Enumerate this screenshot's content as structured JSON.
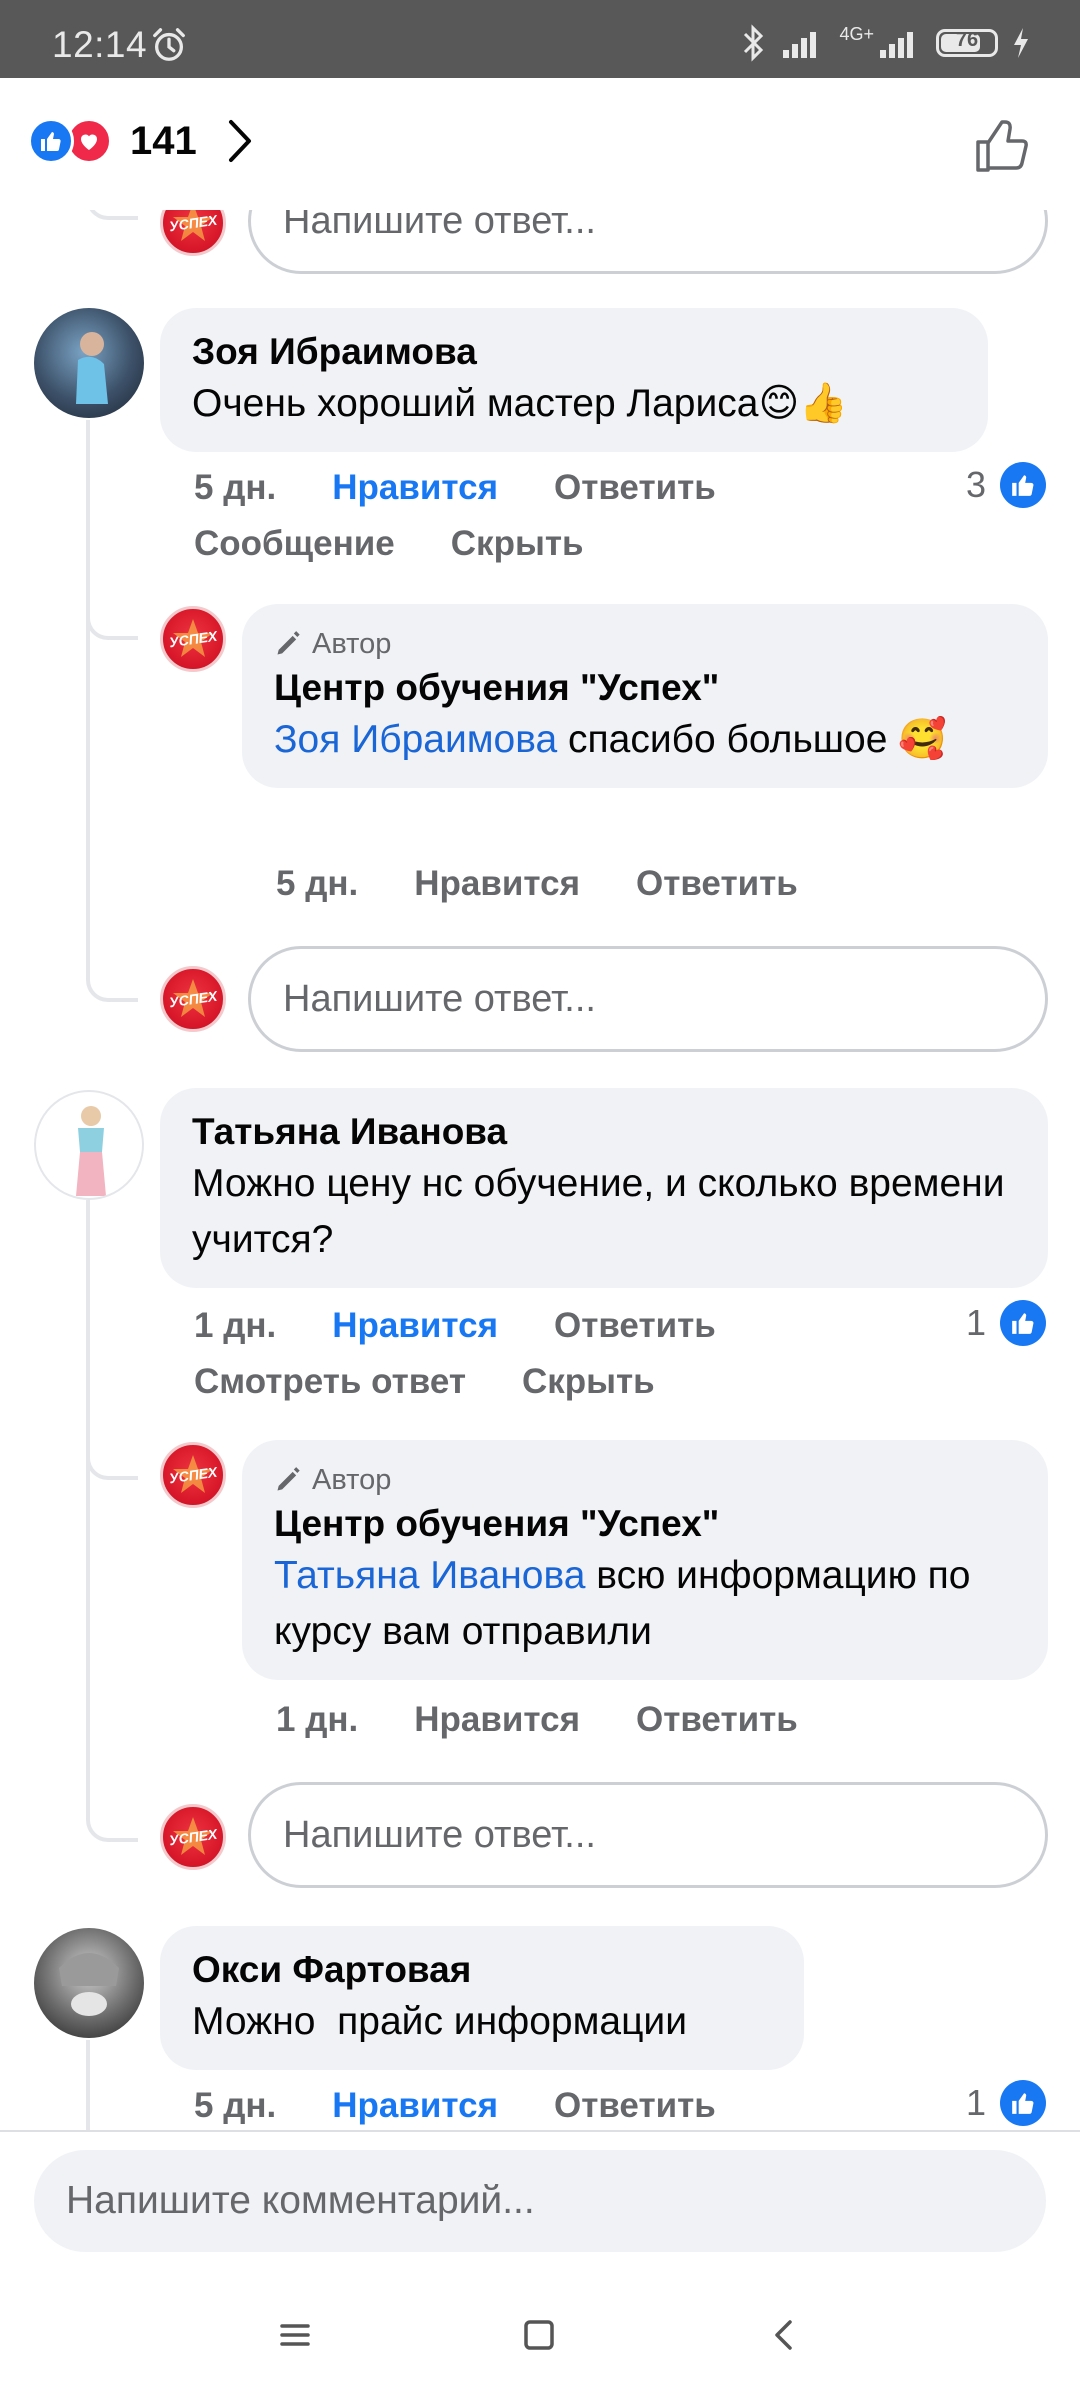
{
  "status_bar": {
    "time": "12:14",
    "network": "4G+",
    "battery": "76"
  },
  "header": {
    "reaction_count": "141"
  },
  "reply_placeholder": "Напишите ответ...",
  "comments": [
    {
      "name": "Зоя Ибраимова",
      "text": "Очень хороший мастер Лариса😊👍",
      "time": "5 дн.",
      "like_label": "Нравится",
      "reply_label": "Ответить",
      "message_label": "Сообщение",
      "hide_label": "Скрыть",
      "likes": "3",
      "reply": {
        "author_tag": "Автор",
        "name": "Центр обучения \"Успех\"",
        "mention": "Зоя Ибраимова",
        "text": " спасибо большое 🥰",
        "time": "5 дн.",
        "like_label": "Нравится",
        "reply_label": "Ответить"
      }
    },
    {
      "name": "Татьяна Иванова",
      "text": "Можно цену нс обучение, и сколько времени учится?",
      "time": "1 дн.",
      "like_label": "Нравится",
      "reply_label": "Ответить",
      "view_reply_label": "Смотреть ответ",
      "hide_label": "Скрыть",
      "likes": "1",
      "reply": {
        "author_tag": "Автор",
        "name": "Центр обучения \"Успех\"",
        "mention": "Татьяна Иванова",
        "text": " всю информацию по курсу вам отправили",
        "time": "1 дн.",
        "like_label": "Нравится",
        "reply_label": "Ответить"
      }
    },
    {
      "name": "Окси Фартовая",
      "text": "Можно  прайс информации",
      "time": "5 дн.",
      "like_label": "Нравится",
      "reply_label": "Ответить",
      "likes": "1"
    }
  ],
  "composer": {
    "placeholder": "Напишите комментарий..."
  },
  "colors": {
    "accent": "#1877f2",
    "love": "#f0284a",
    "bubble": "#f0f2f5",
    "secondary_text": "#65676b",
    "status_bar": "#585858"
  }
}
